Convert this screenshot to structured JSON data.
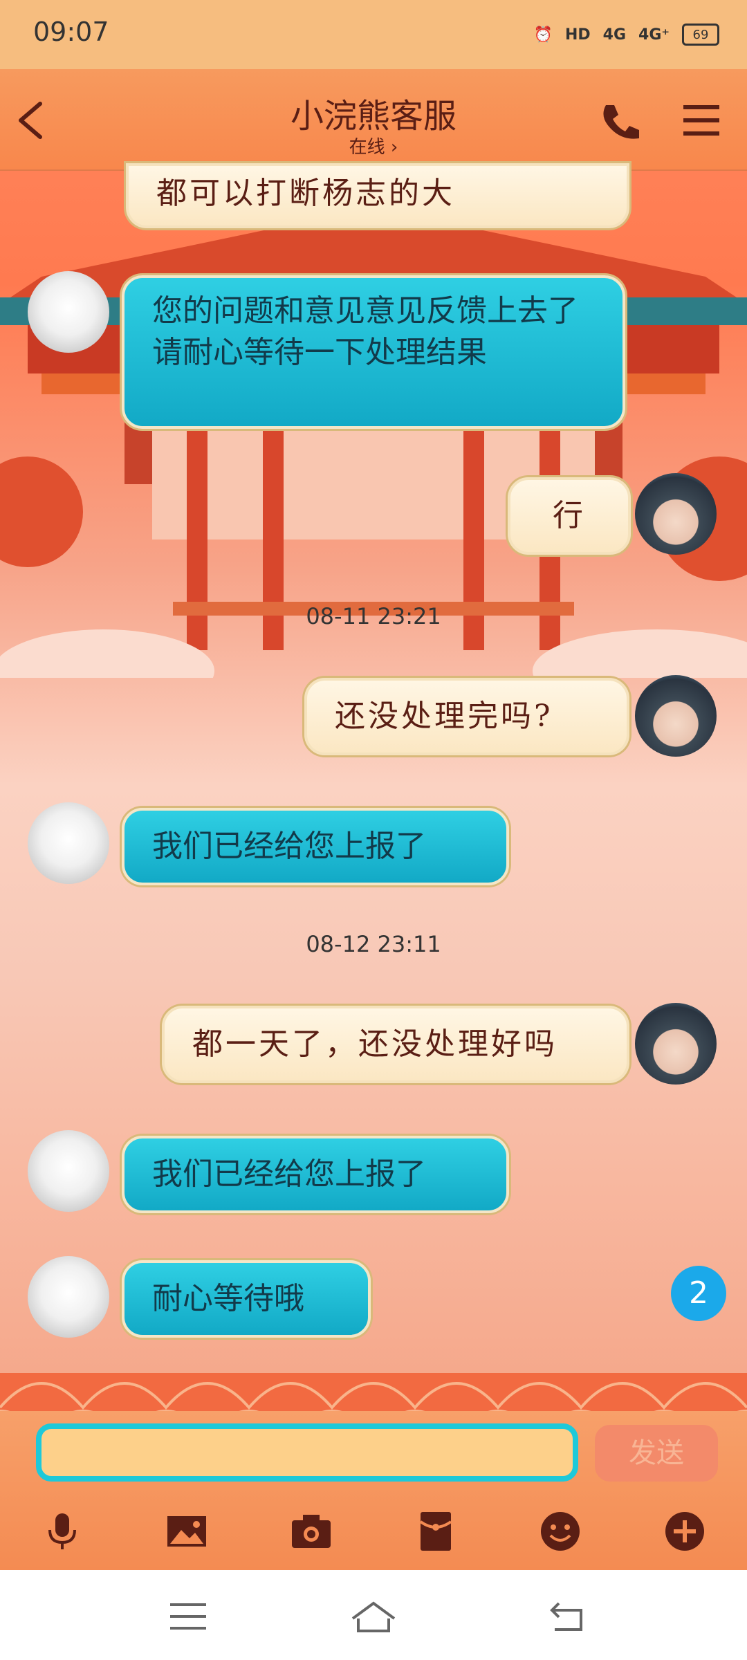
{
  "status_bar": {
    "time": "09:07",
    "battery": "69",
    "signal1": "4G",
    "signal2": "4G⁺",
    "hd": "HD"
  },
  "header": {
    "title": "小浣熊客服",
    "subtitle": "在线 ›"
  },
  "messages": {
    "m0": {
      "text": "都可以打断杨志的大",
      "sender": "self"
    },
    "m1": {
      "text": "您的问题和意见意见反馈上去了 请耐心等待一下处理结果",
      "sender": "agent"
    },
    "m2": {
      "text": "行",
      "sender": "self"
    },
    "t1": "08-11 23:21",
    "m3": {
      "text": "还没处理完吗?",
      "sender": "self"
    },
    "m4": {
      "text": "我们已经给您上报了",
      "sender": "agent"
    },
    "t2": "08-12 23:11",
    "m5": {
      "text": "都一天了，还没处理好吗",
      "sender": "self"
    },
    "m6": {
      "text": "我们已经给您上报了",
      "sender": "agent"
    },
    "m7": {
      "text": "耐心等待哦",
      "sender": "agent"
    }
  },
  "unread_count": "2",
  "input": {
    "value": "",
    "send_label": "发送"
  },
  "toolbar": [
    "microphone-icon",
    "image-icon",
    "camera-icon",
    "red-packet-icon",
    "emoji-icon",
    "plus-icon"
  ],
  "colors": {
    "agent_bubble": "#12a9c6",
    "user_bubble": "#fbe7c3",
    "accent": "#1ec9d9",
    "header": "#f8874c"
  }
}
